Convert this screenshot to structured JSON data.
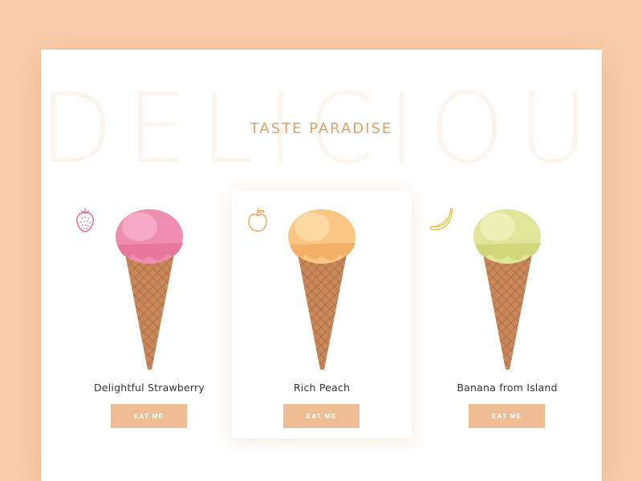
{
  "background_word": "DELICIOUS",
  "headline": "TASTE PARADISE",
  "colors": {
    "page_bg": "#f8cdaa",
    "accent": "#e3a062",
    "button": "#eebd94"
  },
  "products": [
    {
      "name": "Delightful Strawberry",
      "button_label": "EAT ME",
      "icon": "strawberry-icon",
      "scoop_color": "#ef8eb0"
    },
    {
      "name": "Rich Peach",
      "button_label": "EAT ME",
      "icon": "apple-icon",
      "scoop_color": "#f9c783"
    },
    {
      "name": "Banana from Island",
      "button_label": "EAT ME",
      "icon": "banana-icon",
      "scoop_color": "#dfe69a"
    }
  ]
}
